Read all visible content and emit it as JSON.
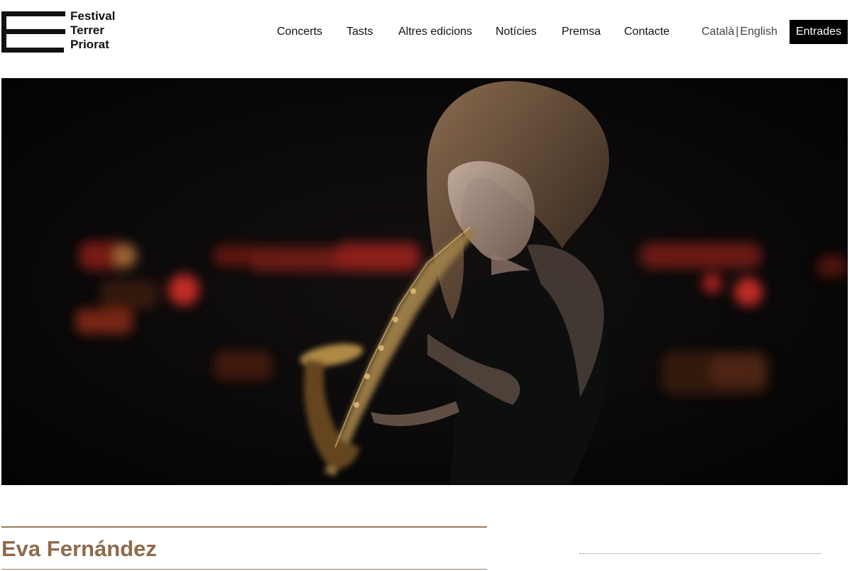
{
  "brand": {
    "logo_lines": [
      "Festival",
      "Terrer",
      "Priorat"
    ]
  },
  "nav": {
    "items": [
      {
        "label": "Concerts"
      },
      {
        "label": "Tasts"
      },
      {
        "label": "Altres edicions"
      },
      {
        "label": "Notícies"
      },
      {
        "label": "Premsa"
      },
      {
        "label": "Contacte"
      }
    ]
  },
  "language": {
    "current": "Català",
    "separator": "|",
    "other": "English"
  },
  "cta": {
    "label": "Entrades"
  },
  "hero": {
    "image_subject": "saxophonist performing on dark stage with red bokeh lights"
  },
  "artist": {
    "name": "Eva Fernández"
  },
  "colors": {
    "accent": "#8f6a4b",
    "rule": "#9b7a5c",
    "text": "#111111",
    "button_bg": "#000000",
    "button_text": "#ffffff"
  }
}
